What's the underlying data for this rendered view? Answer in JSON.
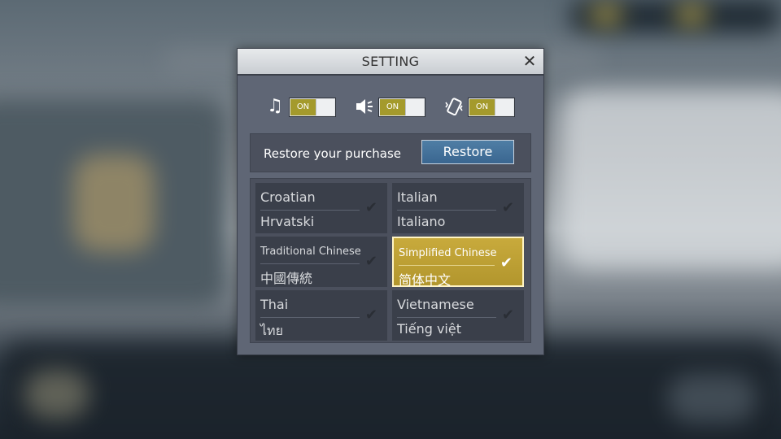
{
  "dialog": {
    "title": "SETTING",
    "close_label": "✕"
  },
  "toggles": [
    {
      "name": "music",
      "icon": "music-note-icon",
      "state": "ON"
    },
    {
      "name": "sound",
      "icon": "speaker-icon",
      "state": "ON"
    },
    {
      "name": "vibration",
      "icon": "vibration-icon",
      "state": "ON"
    }
  ],
  "restore": {
    "label": "Restore your purchase",
    "button": "Restore"
  },
  "languages": [
    {
      "english": "Croatian",
      "native": "Hrvatski",
      "selected": false
    },
    {
      "english": "Italian",
      "native": "Italiano",
      "selected": false
    },
    {
      "english": "Traditional Chinese",
      "native": "中國傳統",
      "selected": false
    },
    {
      "english": "Simplified Chinese",
      "native": "简体中文",
      "selected": true
    },
    {
      "english": "Thai",
      "native": "ไทย",
      "selected": false
    },
    {
      "english": "Vietnamese",
      "native": "Tiếng việt",
      "selected": false
    }
  ],
  "colors": {
    "accent": "#b89c32",
    "restore_button": "#456f99",
    "toggle_on": "#a49a2c"
  }
}
